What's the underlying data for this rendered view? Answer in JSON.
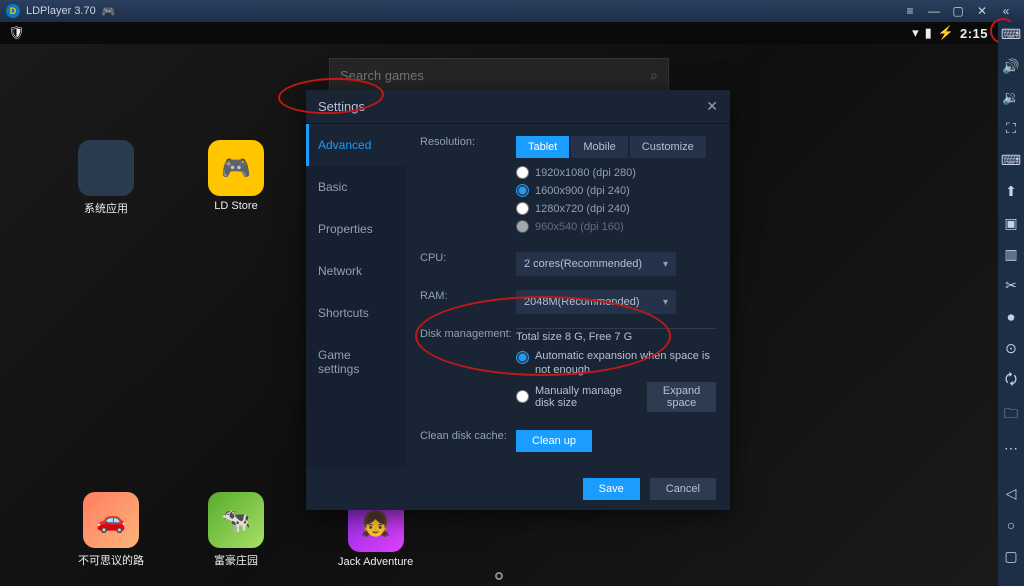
{
  "app": {
    "name": "LDPlayer",
    "version": "3.70"
  },
  "status": {
    "time": "2:15"
  },
  "search": {
    "placeholder": "Search games"
  },
  "apps": {
    "system": "系统应用",
    "ldstore": "LD Store",
    "game1": "不可思议的路",
    "game2": "富豪庄园",
    "game3": "Jack Adventure"
  },
  "settings": {
    "title": "Settings",
    "nav": {
      "advanced": "Advanced",
      "basic": "Basic",
      "properties": "Properties",
      "network": "Network",
      "shortcuts": "Shortcuts",
      "game": "Game settings"
    },
    "resolution": {
      "label": "Resolution:",
      "tabs": {
        "tablet": "Tablet",
        "mobile": "Mobile",
        "custom": "Customize"
      },
      "opts": {
        "r1": "1920x1080  (dpi 280)",
        "r2": "1600x900  (dpi 240)",
        "r3": "1280x720  (dpi 240)",
        "r4": "960x540  (dpi 160)"
      }
    },
    "cpu": {
      "label": "CPU:",
      "value": "2 cores(Recommended)"
    },
    "ram": {
      "label": "RAM:",
      "value": "2048M(Recommended)"
    },
    "disk": {
      "label": "Disk management:",
      "total": "Total size 8 G,  Free 7 G",
      "auto": "Automatic expansion when space is not enough",
      "manual": "Manually manage disk size",
      "expand": "Expand space"
    },
    "clean": {
      "label": "Clean disk cache:",
      "btn": "Clean up"
    },
    "footer": {
      "save": "Save",
      "cancel": "Cancel"
    }
  }
}
